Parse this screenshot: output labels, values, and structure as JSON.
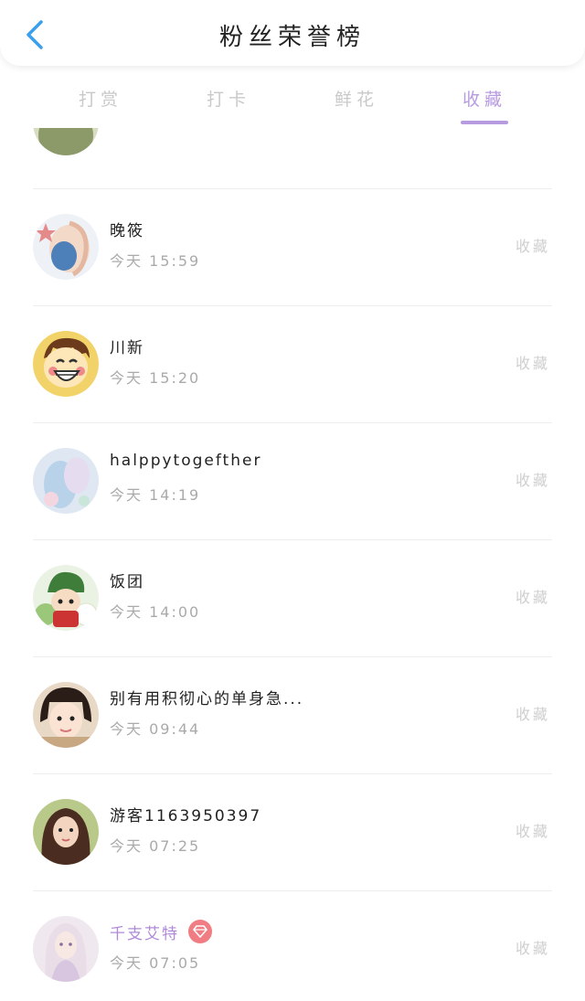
{
  "header": {
    "title": "粉丝荣誉榜",
    "back_icon": "chevron-left-icon",
    "accent": "#3aa0ee"
  },
  "tabs": [
    {
      "label": "打赏",
      "active": false
    },
    {
      "label": "打卡",
      "active": false
    },
    {
      "label": "鲜花",
      "active": false
    },
    {
      "label": "收藏",
      "active": true
    }
  ],
  "colors": {
    "tab_active": "#b79be0",
    "vip_name": "#b08ad9",
    "vip_badge": "#f07d83"
  },
  "fans": [
    {
      "name": "晚筱",
      "time": "今天 15:59",
      "action": "收藏",
      "vip": false
    },
    {
      "name": "川新",
      "time": "今天 15:20",
      "action": "收藏",
      "vip": false
    },
    {
      "name": "halppytogefther",
      "time": "今天 14:19",
      "action": "收藏",
      "vip": false
    },
    {
      "name": "饭团",
      "time": "今天 14:00",
      "action": "收藏",
      "vip": false
    },
    {
      "name": "别有用积彻心的单身急...",
      "time": "今天 09:44",
      "action": "收藏",
      "vip": false
    },
    {
      "name": "游客1163950397",
      "time": "今天 07:25",
      "action": "收藏",
      "vip": false
    },
    {
      "name": "千支艾特",
      "time": "今天 07:05",
      "action": "收藏",
      "vip": true,
      "badge_icon": "diamond-icon"
    }
  ]
}
